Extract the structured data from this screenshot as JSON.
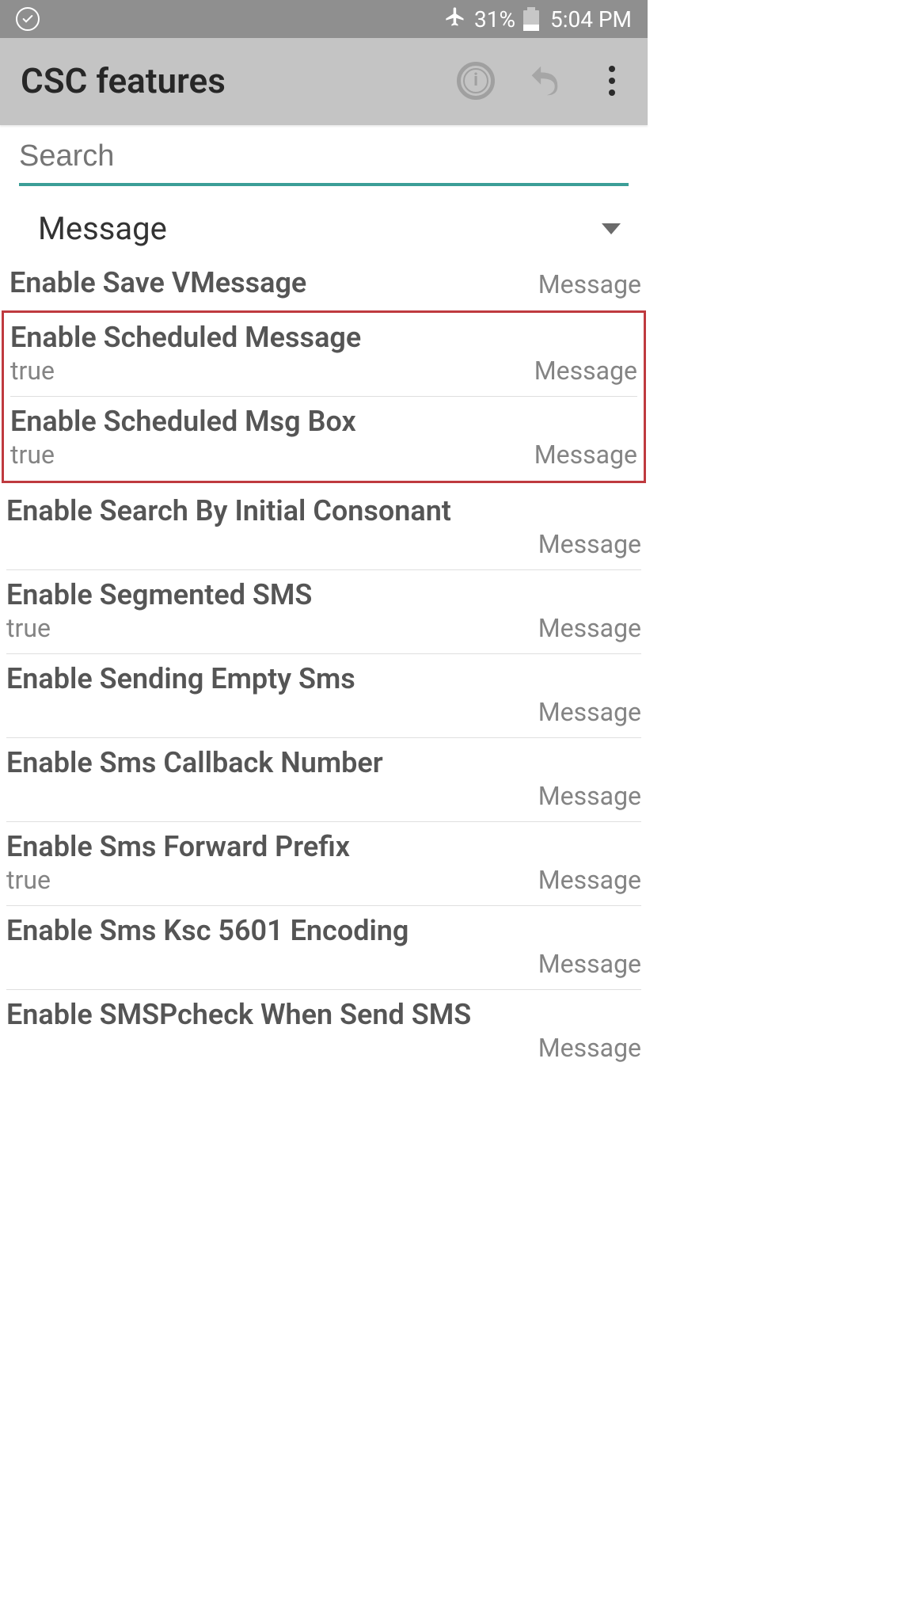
{
  "status": {
    "battery_pct": "31%",
    "time": "5:04 PM"
  },
  "appbar": {
    "title": "CSC features"
  },
  "search": {
    "placeholder": "Search"
  },
  "dropdown": {
    "label": "Message"
  },
  "list": {
    "first_partial_title": "Enable Save VMessage",
    "category_label": "Message",
    "items": [
      {
        "title": "Enable Scheduled Message",
        "value": "true",
        "category": "Message"
      },
      {
        "title": "Enable Scheduled Msg Box",
        "value": "true",
        "category": "Message"
      },
      {
        "title": "Enable Search By Initial Consonant",
        "value": "",
        "category": "Message"
      },
      {
        "title": "Enable Segmented SMS",
        "value": "true",
        "category": "Message"
      },
      {
        "title": "Enable Sending Empty Sms",
        "value": "",
        "category": "Message"
      },
      {
        "title": "Enable Sms Callback Number",
        "value": "",
        "category": "Message"
      },
      {
        "title": "Enable Sms Forward Prefix",
        "value": "true",
        "category": "Message"
      },
      {
        "title": "Enable Sms Ksc 5601 Encoding",
        "value": "",
        "category": "Message"
      },
      {
        "title": "Enable SMSPcheck When Send SMS",
        "value": "",
        "category": "Message"
      }
    ]
  },
  "highlighted_indices": [
    0,
    1
  ]
}
